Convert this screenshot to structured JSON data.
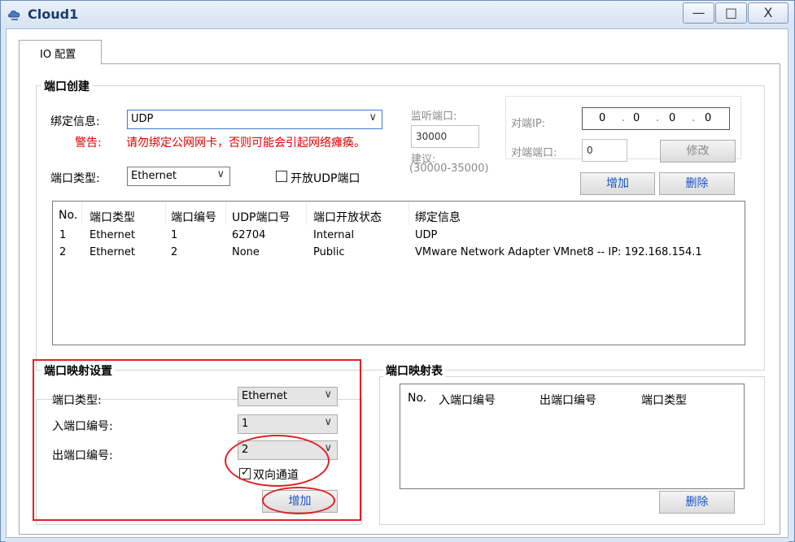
{
  "window": {
    "title": "Cloud1",
    "controls": {
      "minimize": "—",
      "maximize": "□",
      "close": "X"
    }
  },
  "tab": {
    "label": "IO 配置"
  },
  "port_creation": {
    "title": "端口创建",
    "bind_info_label": "绑定信息:",
    "bind_info_value": "UDP",
    "warning_label": "警告:",
    "warning_text": "请勿绑定公网网卡，否则可能会引起网络瘫痪。",
    "port_type_label": "端口类型:",
    "port_type_value": "Ethernet",
    "open_udp_label": "开放UDP端口",
    "open_udp_checked": false,
    "listen_port_label": "监听端口:",
    "listen_port_value": "30000",
    "suggest_label": "建议:",
    "suggest_range": "(30000-35000)",
    "peer_ip_label": "对端IP:",
    "peer_ip": [
      "0",
      "0",
      "0",
      "0"
    ],
    "peer_port_label": "对端端口:",
    "peer_port_value": "0",
    "modify_button": "修改",
    "add_button": "增加",
    "delete_button": "删除",
    "table": {
      "headers": [
        "No.",
        "端口类型",
        "端口编号",
        "UDP端口号",
        "端口开放状态",
        "绑定信息"
      ],
      "rows": [
        [
          "1",
          "Ethernet",
          "1",
          "62704",
          "Internal",
          "UDP"
        ],
        [
          "2",
          "Ethernet",
          "2",
          "None",
          "Public",
          "VMware Network Adapter VMnet8 -- IP: 192.168.154.1"
        ]
      ]
    }
  },
  "port_mapping_settings": {
    "title": "端口映射设置",
    "port_type_label": "端口类型:",
    "port_type_value": "Ethernet",
    "in_port_label": "入端口编号:",
    "in_port_value": "1",
    "out_port_label": "出端口编号:",
    "out_port_value": "2",
    "bidirectional_label": "双向通道",
    "bidirectional_checked": true,
    "add_button": "增加"
  },
  "port_mapping_table": {
    "title": "端口映射表",
    "headers": [
      "No.",
      "入端口编号",
      "出端口编号",
      "端口类型"
    ],
    "delete_button": "删除"
  },
  "colors": {
    "accent_blue": "#1a53c4",
    "warning_red": "#e00000",
    "annotation_red": "#e32026",
    "title_bar": "#d5e3f4"
  }
}
